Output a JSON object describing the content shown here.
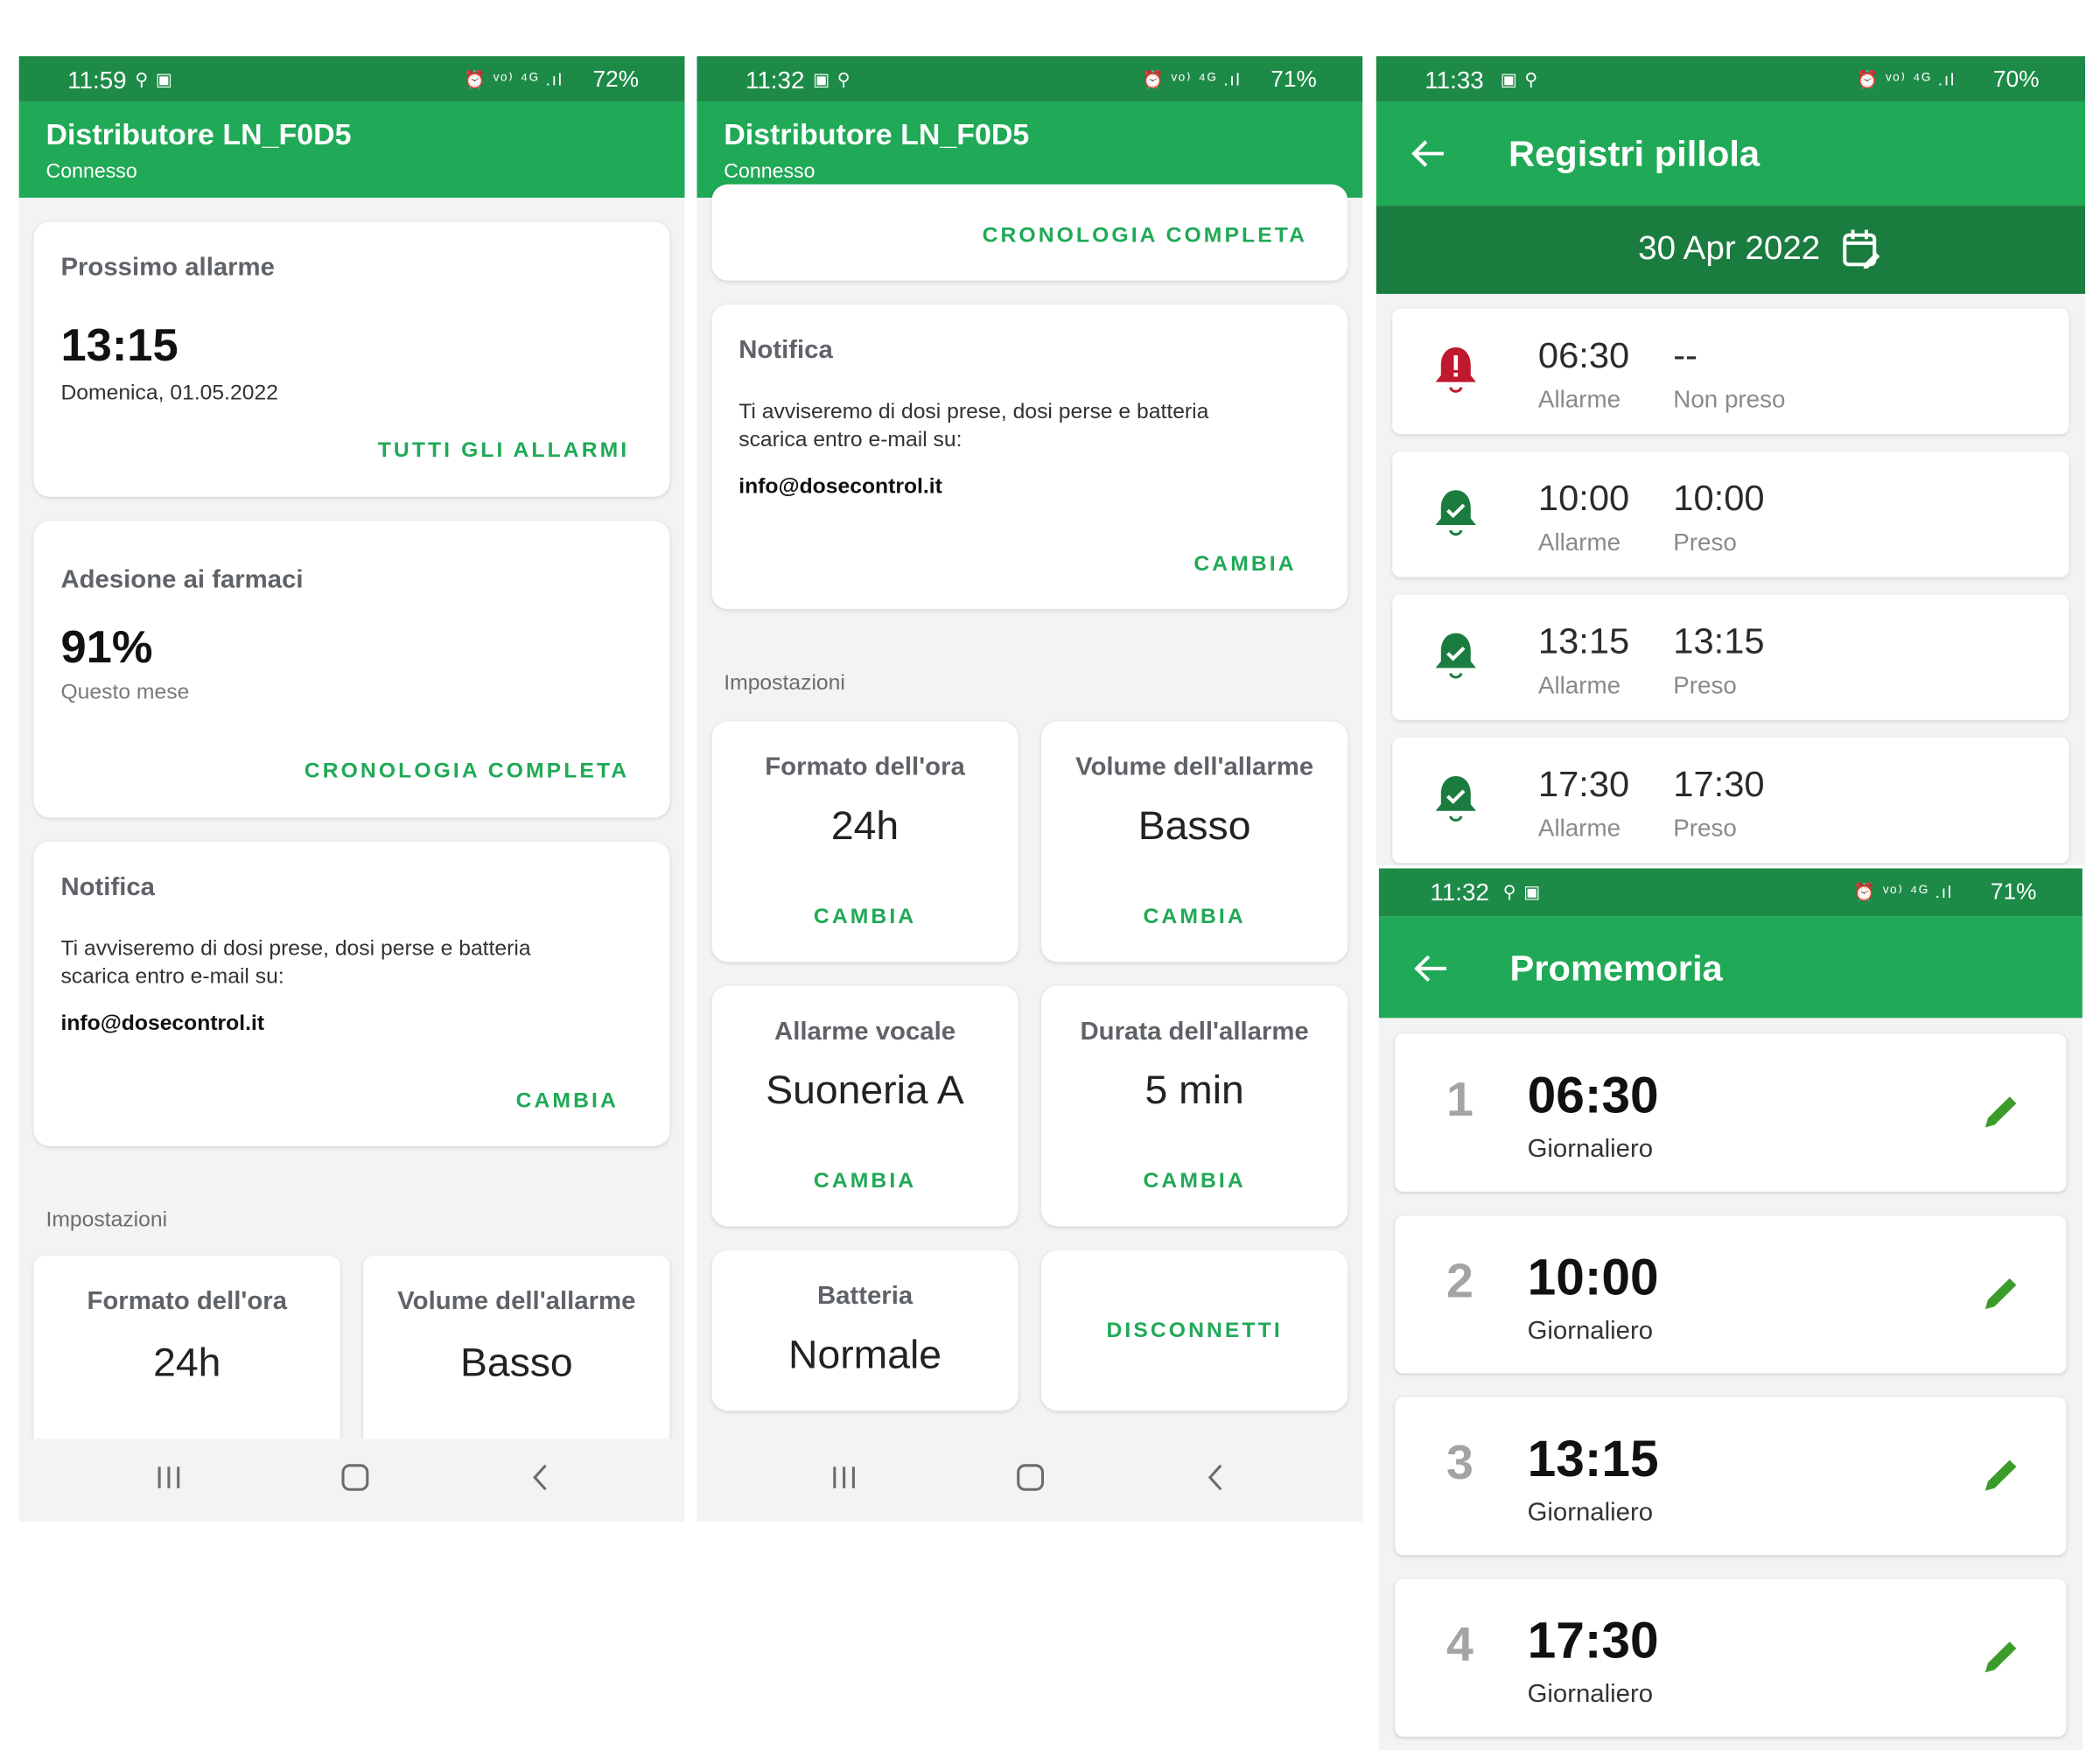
{
  "panel1": {
    "status": {
      "time": "11:59",
      "left_icons": "⚲ ▣",
      "right_icons": "⏰ ᵛᵒ⁾ ⁴ᴳ .ıl",
      "battery": "72%"
    },
    "appbar": {
      "title": "Distributore LN_F0D5",
      "subtitle": "Connesso"
    },
    "next_alarm": {
      "header": "Prossimo allarme",
      "time": "13:15",
      "date": "Domenica, 01.05.2022",
      "action": "TUTTI GLI ALLARMI"
    },
    "adherence": {
      "header": "Adesione ai farmaci",
      "value": "91%",
      "period": "Questo mese",
      "action": "CRONOLOGIA COMPLETA"
    },
    "notification": {
      "header": "Notifica",
      "text1": "Ti avviseremo di dosi prese, dosi perse e batteria",
      "text2": "scarica entro e-mail su:",
      "email": "info@dosecontrol.it",
      "action": "CAMBIA"
    },
    "settings_label": "Impostazioni",
    "tiles": [
      {
        "header": "Formato dell'ora",
        "value": "24h"
      },
      {
        "header": "Volume dell'allarme",
        "value": "Basso"
      }
    ]
  },
  "panel2": {
    "status": {
      "time": "11:32",
      "left_icons": "▣ ⚲",
      "right_icons": "⏰ ᵛᵒ⁾ ⁴ᴳ .ıl",
      "battery": "71%"
    },
    "appbar": {
      "title": "Distributore LN_F0D5",
      "subtitle": "Connesso"
    },
    "history_action": "CRONOLOGIA COMPLETA",
    "notification": {
      "header": "Notifica",
      "text1": "Ti avviseremo di dosi prese, dosi perse e batteria",
      "text2": "scarica entro e-mail su:",
      "email": "info@dosecontrol.it",
      "action": "CAMBIA"
    },
    "settings_label": "Impostazioni",
    "tiles": [
      {
        "header": "Formato dell'ora",
        "value": "24h",
        "action": "CAMBIA"
      },
      {
        "header": "Volume dell'allarme",
        "value": "Basso",
        "action": "CAMBIA"
      },
      {
        "header": "Allarme vocale",
        "value": "Suoneria A",
        "action": "CAMBIA"
      },
      {
        "header": "Durata dell'allarme",
        "value": "5 min",
        "action": "CAMBIA"
      },
      {
        "header": "Batteria",
        "value": "Normale"
      }
    ],
    "disconnect": "DISCONNETTI"
  },
  "panel3": {
    "status": {
      "time": "11:33",
      "left_icons": "▣ ⚲",
      "right_icons": "⏰ ᵛᵒ⁾ ⁴ᴳ .ıl",
      "battery": "70%"
    },
    "title": "Registri pillola",
    "date": "30 Apr 2022",
    "rows": [
      {
        "alarm": "06:30",
        "alarm_label": "Allarme",
        "taken": "--",
        "taken_label": "Non preso",
        "status": "missed"
      },
      {
        "alarm": "10:00",
        "alarm_label": "Allarme",
        "taken": "10:00",
        "taken_label": "Preso",
        "status": "taken"
      },
      {
        "alarm": "13:15",
        "alarm_label": "Allarme",
        "taken": "13:15",
        "taken_label": "Preso",
        "status": "taken"
      },
      {
        "alarm": "17:30",
        "alarm_label": "Allarme",
        "taken": "17:30",
        "taken_label": "Preso",
        "status": "taken"
      }
    ]
  },
  "panel4": {
    "status": {
      "time": "11:32",
      "left_icons": "⚲ ▣",
      "right_icons": "⏰ ᵛᵒ⁾ ⁴ᴳ .ıl",
      "battery": "71%"
    },
    "title": "Promemoria",
    "reminders": [
      {
        "num": "1",
        "time": "06:30",
        "freq": "Giornaliero"
      },
      {
        "num": "2",
        "time": "10:00",
        "freq": "Giornaliero"
      },
      {
        "num": "3",
        "time": "13:15",
        "freq": "Giornaliero"
      },
      {
        "num": "4",
        "time": "17:30",
        "freq": "Giornaliero"
      }
    ]
  },
  "colors": {
    "primary": "#20a956",
    "primary_dark": "#1a7c3f",
    "danger": "#c0182e",
    "pencil": "#3c9c2a"
  }
}
